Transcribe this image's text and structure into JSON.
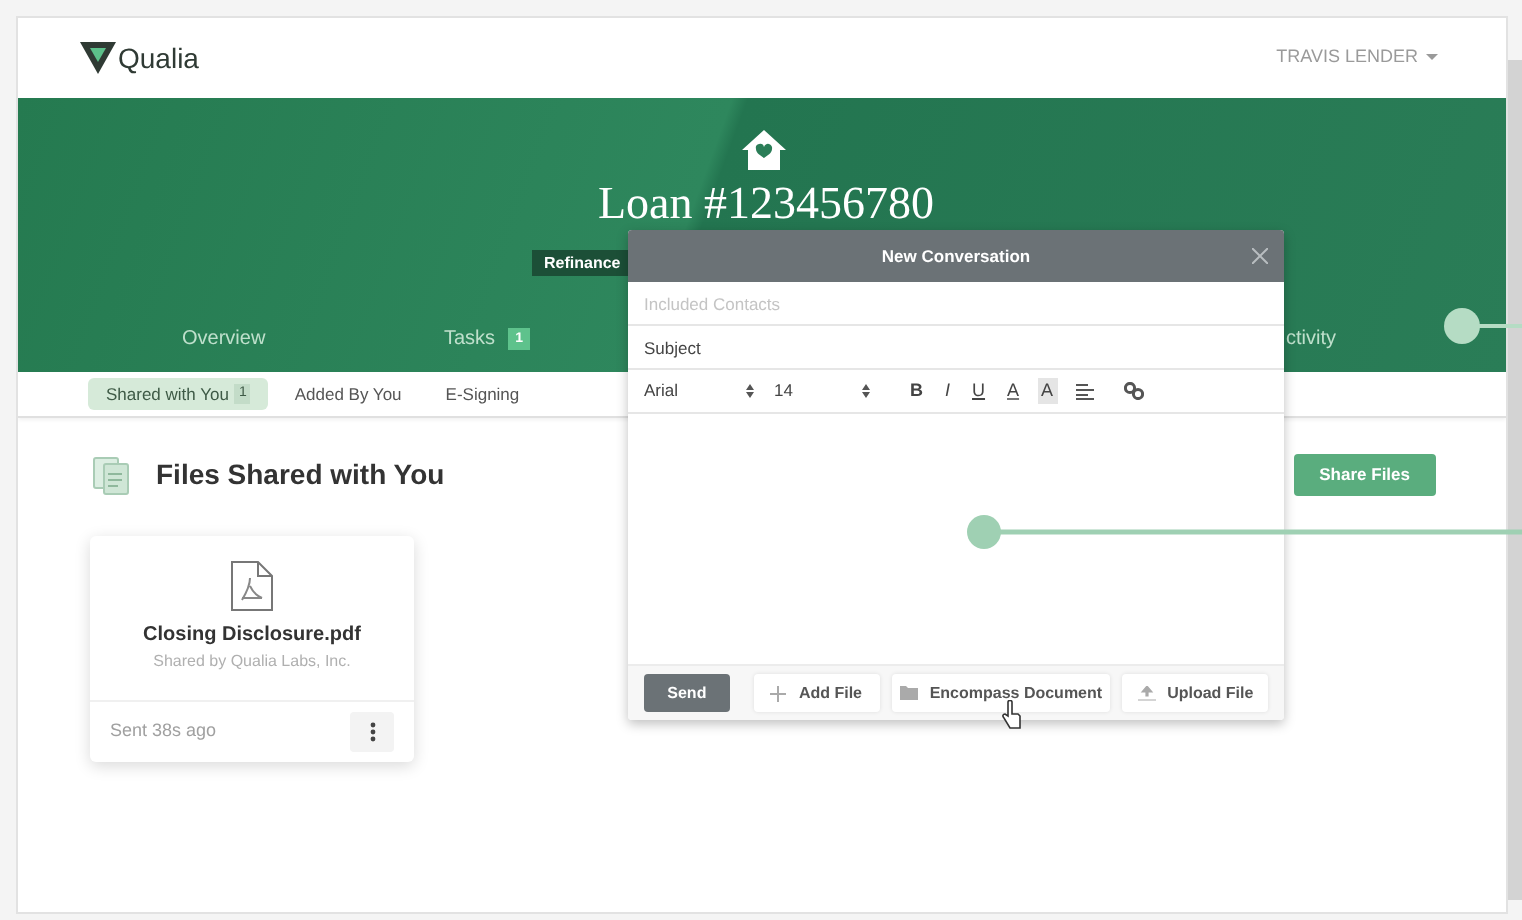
{
  "header": {
    "logo": "Qualia",
    "user": "TRAVIS LENDER"
  },
  "banner": {
    "title": "Loan #123456780",
    "tag": "Refinance"
  },
  "nav_tabs": [
    {
      "label": "Overview"
    },
    {
      "label": "Tasks",
      "badge": "1"
    },
    {
      "label": "ctivity"
    }
  ],
  "sub_tabs": [
    {
      "label": "Shared with You",
      "count": "1",
      "selected": true
    },
    {
      "label": "Added By You",
      "selected": false
    },
    {
      "label": "E-Signing",
      "selected": false
    }
  ],
  "section": {
    "title": "Files Shared with You",
    "action": "Share Files"
  },
  "files": [
    {
      "name": "Closing Disclosure.pdf",
      "shared_by": "Shared by Qualia Labs, Inc.",
      "sent": "Sent 38s ago"
    }
  ],
  "modal": {
    "title": "New Conversation",
    "contacts_placeholder": "Included Contacts",
    "subject_placeholder": "Subject",
    "font": "Arial",
    "size": "14",
    "format": [
      {
        "label": "B",
        "kind": "bold"
      },
      {
        "label": "I",
        "kind": "italic"
      },
      {
        "label": "U",
        "kind": "underline"
      },
      {
        "label": "A",
        "kind": "color"
      },
      {
        "label": "A",
        "kind": "highlight"
      }
    ],
    "send": "Send",
    "actions": [
      {
        "label": "Add File",
        "kind": "add"
      },
      {
        "label": "Encompass Document",
        "kind": "folder"
      },
      {
        "label": "Upload File",
        "kind": "upload"
      }
    ]
  }
}
